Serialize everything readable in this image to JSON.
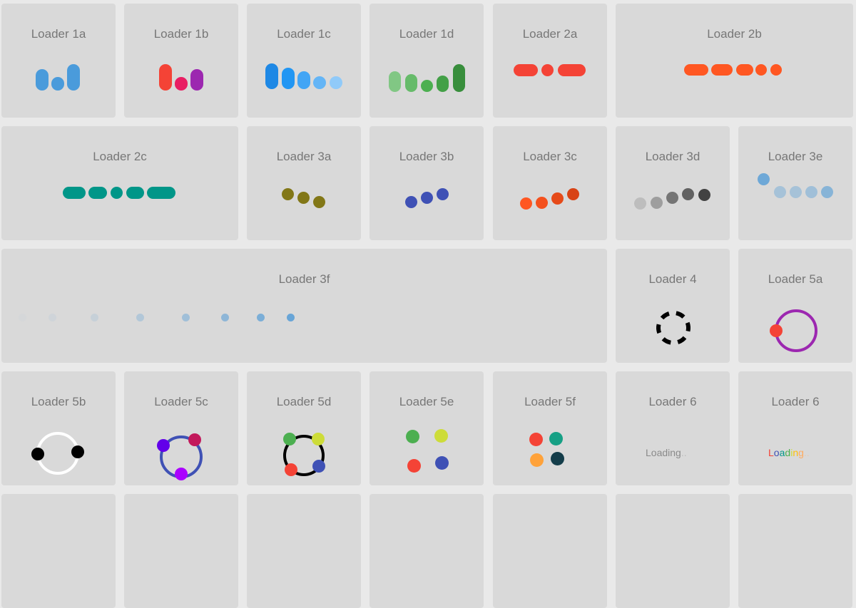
{
  "cards": [
    {
      "title": "Loader 1a"
    },
    {
      "title": "Loader 1b"
    },
    {
      "title": "Loader 1c"
    },
    {
      "title": "Loader 1d"
    },
    {
      "title": "Loader 2a"
    },
    {
      "title": "Loader 2b"
    },
    {
      "title": "Loader 2c"
    },
    {
      "title": "Loader 3a"
    },
    {
      "title": "Loader 3b"
    },
    {
      "title": "Loader 3c"
    },
    {
      "title": "Loader 3d"
    },
    {
      "title": "Loader 3e"
    },
    {
      "title": "Loader 3f"
    },
    {
      "title": "Loader 4"
    },
    {
      "title": "Loader 5a"
    },
    {
      "title": "Loader 5b"
    },
    {
      "title": "Loader 5c"
    },
    {
      "title": "Loader 5d"
    },
    {
      "title": "Loader 5e"
    },
    {
      "title": "Loader 5f"
    },
    {
      "title": "Loader 6",
      "text": "Loading",
      "dots": ".."
    },
    {
      "title": "Loader 6",
      "letters": [
        "L",
        "o",
        "a",
        "d",
        "i",
        "n",
        "g"
      ],
      "dots": ".."
    }
  ],
  "colors": {
    "background": "#e9e9e9",
    "card": "#d9d9d9",
    "title": "#777777",
    "loader1a": "#4a9bdb",
    "loader1b": [
      "#f44336",
      "#e91e63",
      "#9c27b0"
    ],
    "loader1c": [
      "#1e88e5",
      "#2196f3",
      "#42a5f5",
      "#64b5f6",
      "#90caf9"
    ],
    "loader1d": [
      "#81c784",
      "#66bb6a",
      "#4caf50",
      "#43a047",
      "#388e3c"
    ],
    "loader2a": "#f44336",
    "loader2b": "#ff5722",
    "loader2c": "#009688",
    "loader3a": "#827717",
    "loader3b": "#3f51b5",
    "loader3c": [
      "#ff5722",
      "#f4511e",
      "#e64a19",
      "#d84315"
    ],
    "loader3d": [
      "#bdbdbd",
      "#9e9e9e",
      "#757575",
      "#616161",
      "#424242"
    ],
    "loader3e": "#5b9fd6",
    "loader3f": "#5b9fd6",
    "loader5a": [
      "#9c27b0",
      "#f44336"
    ],
    "loader5c": [
      "#3f51b5",
      "#6200ea",
      "#c2185b",
      "#aa00ff"
    ],
    "loader5d": [
      "#4caf50",
      "#cddc39",
      "#f44336",
      "#3f51b5"
    ],
    "loader5f": [
      "#f44336",
      "#16a085",
      "#ffa23a",
      "#143d4a"
    ],
    "loader6b": [
      "#f44336",
      "#3f51b5",
      "#009688",
      "#4caf50",
      "#cddc39",
      "#ffc107",
      "#ff9800"
    ]
  }
}
